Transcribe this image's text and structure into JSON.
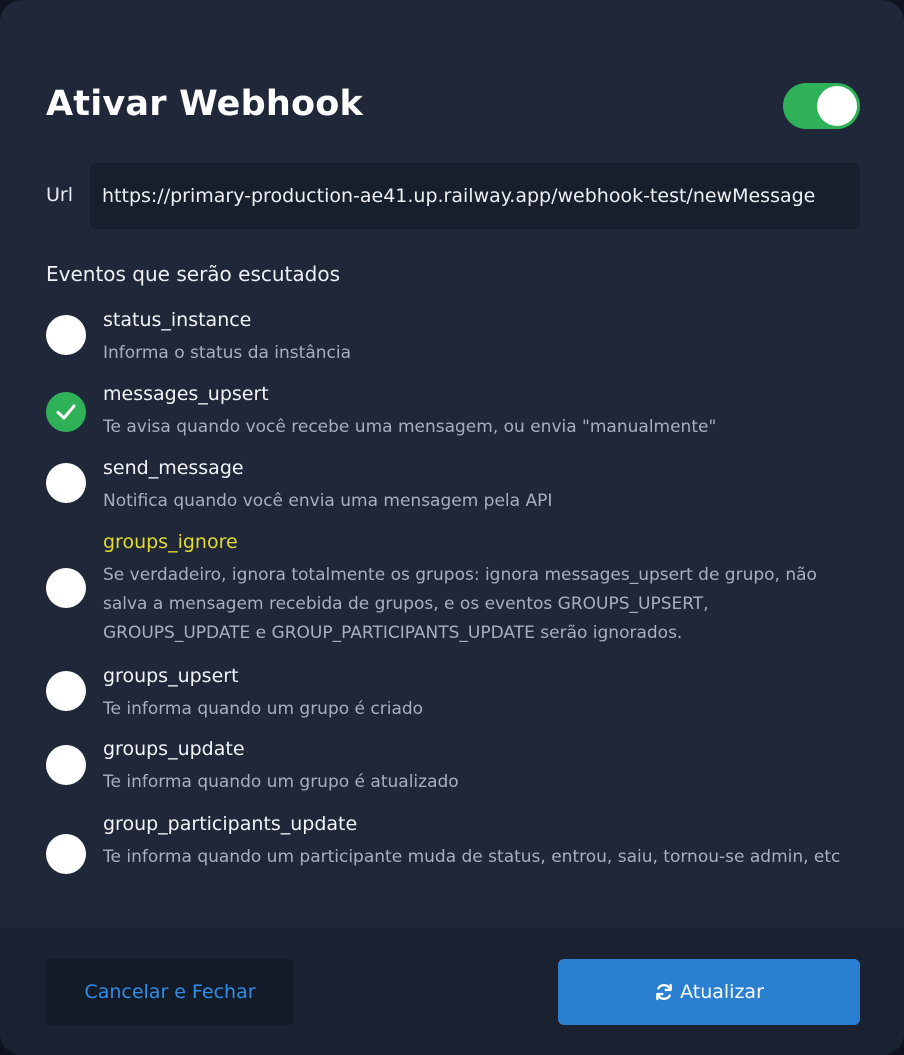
{
  "title": "Ativar Webhook",
  "webhook_enabled": true,
  "url": {
    "label": "Url",
    "value": "https://primary-production-ae41.up.railway.app/webhook-test/newMessage"
  },
  "events_title": "Eventos que serão escutados",
  "events": [
    {
      "name": "status_instance",
      "description": "Informa o status da instância",
      "checked": false
    },
    {
      "name": "messages_upsert",
      "description": "Te avisa quando você recebe uma mensagem, ou envia \"manualmente\"",
      "checked": true
    },
    {
      "name": "send_message",
      "description": "Notifica quando você envia uma mensagem pela API",
      "checked": false
    },
    {
      "name": "groups_ignore",
      "description": "Se verdadeiro, ignora totalmente os grupos: ignora messages_upsert de grupo, não salva a mensagem recebida de grupos, e os eventos GROUPS_UPSERT, GROUPS_UPDATE e GROUP_PARTICIPANTS_UPDATE serão ignorados.",
      "checked": false
    },
    {
      "name": "groups_upsert",
      "description": "Te informa quando um grupo é criado",
      "checked": false
    },
    {
      "name": "groups_update",
      "description": "Te informa quando um grupo é atualizado",
      "checked": false
    },
    {
      "name": "group_participants_update",
      "description": "Te informa quando um participante muda de status, entrou, saiu, tornou-se admin, etc",
      "checked": false
    }
  ],
  "buttons": {
    "cancel": "Cancelar e Fechar",
    "update": "Atualizar",
    "update_icon": "refresh-icon"
  },
  "colors": {
    "accent_green": "#2fb158",
    "highlight_yellow": "#e3dc2e",
    "primary_blue": "#2a7fd1"
  }
}
